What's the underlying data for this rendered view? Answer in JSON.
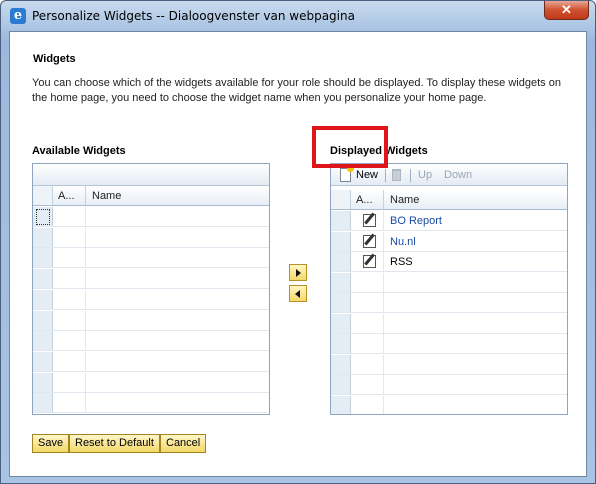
{
  "window": {
    "title": "Personalize Widgets -- Dialoogvenster van webpagina",
    "close_glyph": "✕"
  },
  "section_title": "Widgets",
  "description": "You can choose which of the widgets available for your role should be displayed. To display these widgets on the home page, you need to choose the widget name when you personalize your home page.",
  "available": {
    "label": "Available Widgets",
    "col_a": "A...",
    "col_name": "Name",
    "rows": [
      "",
      "",
      "",
      "",
      "",
      "",
      "",
      "",
      "",
      ""
    ]
  },
  "displayed": {
    "label": "Displayed Widgets",
    "toolbar": {
      "new": "New",
      "up": "Up",
      "down": "Down"
    },
    "col_a": "A...",
    "col_name": "Name",
    "rows": [
      {
        "name": "BO Report",
        "is_link": true
      },
      {
        "name": "Nu.nl",
        "is_link": true
      },
      {
        "name": "RSS",
        "is_link": false
      },
      {
        "name": "",
        "is_link": false
      },
      {
        "name": "",
        "is_link": false
      },
      {
        "name": "",
        "is_link": false
      },
      {
        "name": "",
        "is_link": false
      },
      {
        "name": "",
        "is_link": false
      },
      {
        "name": "",
        "is_link": false
      },
      {
        "name": "",
        "is_link": false
      }
    ]
  },
  "buttons": {
    "save": "Save",
    "reset": "Reset to Default",
    "cancel": "Cancel"
  },
  "colors": {
    "highlight": "#e0151b",
    "link": "#1a4aa8",
    "button_bg": "#f3d767"
  },
  "icons": [
    "ie-icon",
    "close-icon",
    "new-document-icon",
    "trash-icon",
    "edit-icon",
    "arrow-right-icon",
    "arrow-left-icon"
  ]
}
